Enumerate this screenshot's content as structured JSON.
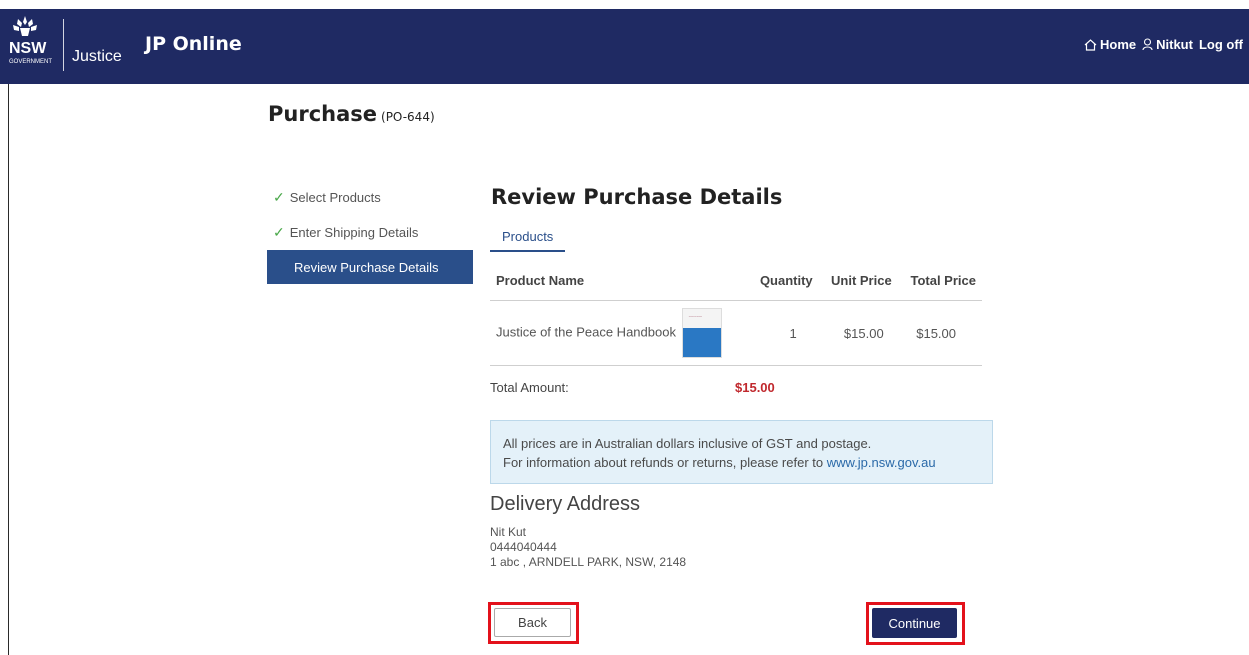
{
  "header": {
    "brand_nsw": "NSW",
    "brand_gov": "GOVERNMENT",
    "brand_justice": "Justice",
    "app_title": "JP Online",
    "nav": {
      "home": "Home",
      "user": "Nitkut",
      "logoff": "Log off"
    }
  },
  "page": {
    "title": "Purchase",
    "order_id": "(PO-644)"
  },
  "steps": [
    {
      "label": "Select Products",
      "done": true
    },
    {
      "label": "Enter Shipping Details",
      "done": true
    },
    {
      "label": "Review Purchase Details",
      "active": true
    }
  ],
  "review": {
    "title": "Review Purchase Details",
    "tab": "Products",
    "columns": {
      "name": "Product Name",
      "qty": "Quantity",
      "unit": "Unit Price",
      "total": "Total Price"
    },
    "items": [
      {
        "name": "Justice of the Peace Handbook",
        "qty": "1",
        "unit": "$15.00",
        "total": "$15.00"
      }
    ],
    "total_label": "Total Amount:",
    "total_value": "$15.00"
  },
  "info": {
    "line1": "All prices are in Australian dollars inclusive of GST and postage.",
    "line2_prefix": "For information about refunds or returns, please refer to ",
    "line2_link": "www.jp.nsw.gov.au"
  },
  "delivery": {
    "title": "Delivery Address",
    "name": "Nit Kut",
    "phone": "0444040444",
    "address": "1 abc , ARNDELL PARK, NSW, 2148"
  },
  "buttons": {
    "back": "Back",
    "continue": "Continue"
  },
  "colors": {
    "header_bg": "#1f2a63",
    "active_step": "#2a4f8a",
    "total_red": "#c0282d",
    "highlight_red": "#e3111b"
  }
}
